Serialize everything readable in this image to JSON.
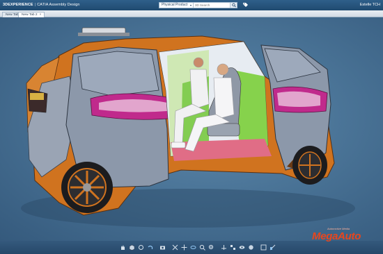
{
  "app": {
    "brand_prefix": "3DEXPERIENCE",
    "separator": "|",
    "brand_suffix": "CATIA Assembly Design",
    "user": "Estelle TCH"
  },
  "context": {
    "selected": "Physical Product",
    "search_placeholder": "3D Search"
  },
  "tabs": [
    {
      "label": "New Tab 1",
      "active": false
    },
    {
      "label": "New Tab 2",
      "active": true
    }
  ],
  "toolbar": {
    "icons": [
      "hand-icon",
      "cube-icon",
      "refresh-icon",
      "undo-icon",
      "camera-icon",
      "fit-all-icon",
      "pan-icon",
      "rotate-icon",
      "zoom-icon",
      "zoom-in-icon",
      "normal-view-icon",
      "multi-view-icon",
      "eye-icon",
      "shading-icon",
      "views-icon",
      "section-icon"
    ]
  },
  "watermark": {
    "tagline": "Automotive Media",
    "name": "MegaAuto"
  },
  "colors": {
    "body_orange": "#d0731f",
    "panel_grey": "#8c98aa",
    "accent_magenta": "#c02a8c",
    "interior_green": "#7bcf3a",
    "floor_pink": "#e06d86",
    "watermark_red": "#e8461d"
  }
}
